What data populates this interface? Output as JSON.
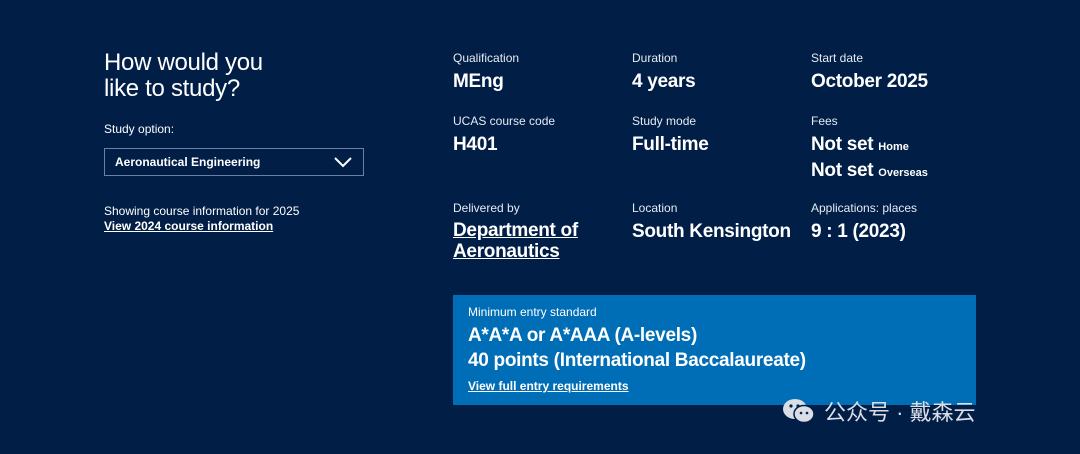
{
  "left": {
    "heading_line1": "How would you",
    "heading_line2": "like to study?",
    "study_option_label": "Study option:",
    "study_option_value": "Aeronautical Engineering",
    "showing_text": "Showing course information for 2025",
    "view_other_year_link": "View 2024 course information"
  },
  "details": {
    "qualification": {
      "label": "Qualification",
      "value": "MEng"
    },
    "duration": {
      "label": "Duration",
      "value": "4 years"
    },
    "start_date": {
      "label": "Start date",
      "value": "October 2025"
    },
    "ucas_code": {
      "label": "UCAS course code",
      "value": "H401"
    },
    "study_mode": {
      "label": "Study mode",
      "value": "Full-time"
    },
    "fees": {
      "label": "Fees",
      "home_value": "Not set",
      "home_suffix": "Home",
      "overseas_value": "Not set",
      "overseas_suffix": "Overseas"
    },
    "delivered_by": {
      "label": "Delivered by",
      "value_line1": "Department of",
      "value_line2": "Aeronautics"
    },
    "location": {
      "label": "Location",
      "value": "South Kensington"
    },
    "applications": {
      "label": "Applications: places",
      "value": "9 : 1 (2023)"
    }
  },
  "entry": {
    "label": "Minimum entry standard",
    "line1": "A*A*A or A*AAA (A-levels)",
    "line2": "40 points (International Baccalaureate)",
    "link": "View full entry requirements"
  },
  "watermark": {
    "text": "公众号 · 戴森云",
    "icon": "wechat-icon"
  },
  "colors": {
    "background": "#001e46",
    "entry_box": "#006eb7",
    "text": "#ffffff"
  }
}
